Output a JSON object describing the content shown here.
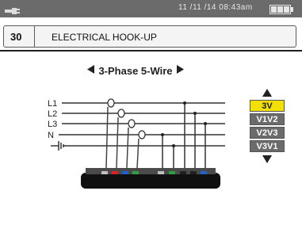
{
  "status": {
    "datetime": "11 /11 /14  08:43am",
    "plug_icon": "power-plug-icon",
    "battery_icon": "battery-icon"
  },
  "header": {
    "code": "30",
    "title": "ELECTRICAL HOOK-UP"
  },
  "mode": {
    "label": "3-Phase 5-Wire",
    "prev_icon": "triangle-left-icon",
    "next_icon": "triangle-right-icon"
  },
  "diagram": {
    "lines": [
      "L1",
      "L2",
      "L3",
      "N",
      "ground"
    ],
    "ground_icon": "ground-symbol-icon",
    "probe_colors": [
      "#c0c0c0",
      "#e02020",
      "#2060d0",
      "#30a040",
      "#c0c0c0",
      "#30a040",
      "#202020",
      "#202020",
      "#2060d0"
    ]
  },
  "selector": {
    "up_icon": "triangle-up-icon",
    "down_icon": "triangle-down-icon",
    "options": [
      "3V",
      "V1V2",
      "V2V3",
      "V3V1"
    ],
    "selected_index": 0,
    "selected_color": "#f2e100"
  }
}
